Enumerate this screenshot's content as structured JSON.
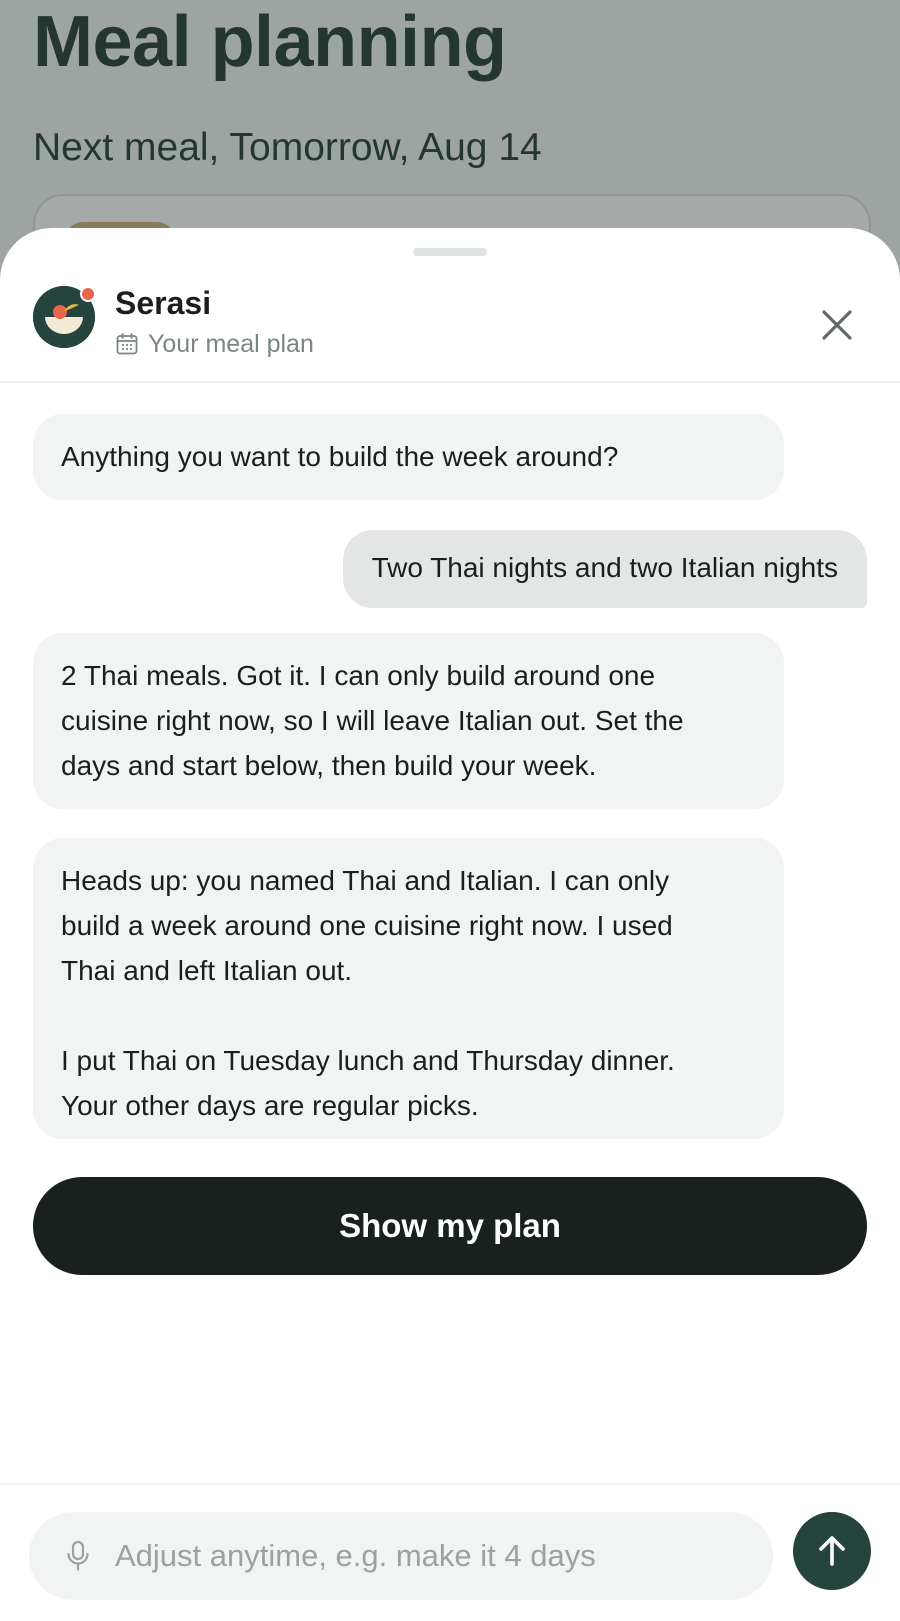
{
  "background": {
    "title": "Meal planning",
    "subtitle": "Next meal, Tomorrow, Aug 14"
  },
  "header": {
    "assistant_name": "Serasi",
    "context_label": "Your meal plan",
    "avatar_icon": "bowl-icon",
    "context_icon": "calendar-icon",
    "close_icon": "close-icon"
  },
  "messages": [
    {
      "role": "assistant",
      "text": "Anything you want to build the week around?"
    },
    {
      "role": "user",
      "text": "Two Thai nights and two Italian nights"
    },
    {
      "role": "assistant",
      "text": "2 Thai meals. Got it. I can only build around one\ncuisine right now, so I will leave Italian out. Set the\ndays and start below, then build your week."
    },
    {
      "role": "assistant",
      "text": "Heads up: you named Thai and Italian. I can only\nbuild a week around one cuisine right now. I used\nThai and left Italian out.\n\nI put Thai on Tuesday lunch and Thursday dinner.\nYour other days are regular picks."
    }
  ],
  "action": {
    "primary_label": "Show my plan"
  },
  "composer": {
    "placeholder": "Adjust anytime, e.g. make it 4 days",
    "value": "",
    "mic_icon": "microphone-icon",
    "send_icon": "arrow-up-icon"
  },
  "colors": {
    "brand_dark": "#24443d",
    "button_dark": "#19211f",
    "assistant_bubble": "#f2f4f3",
    "user_bubble": "#e3e6e5",
    "notification_dot": "#e8654e"
  }
}
